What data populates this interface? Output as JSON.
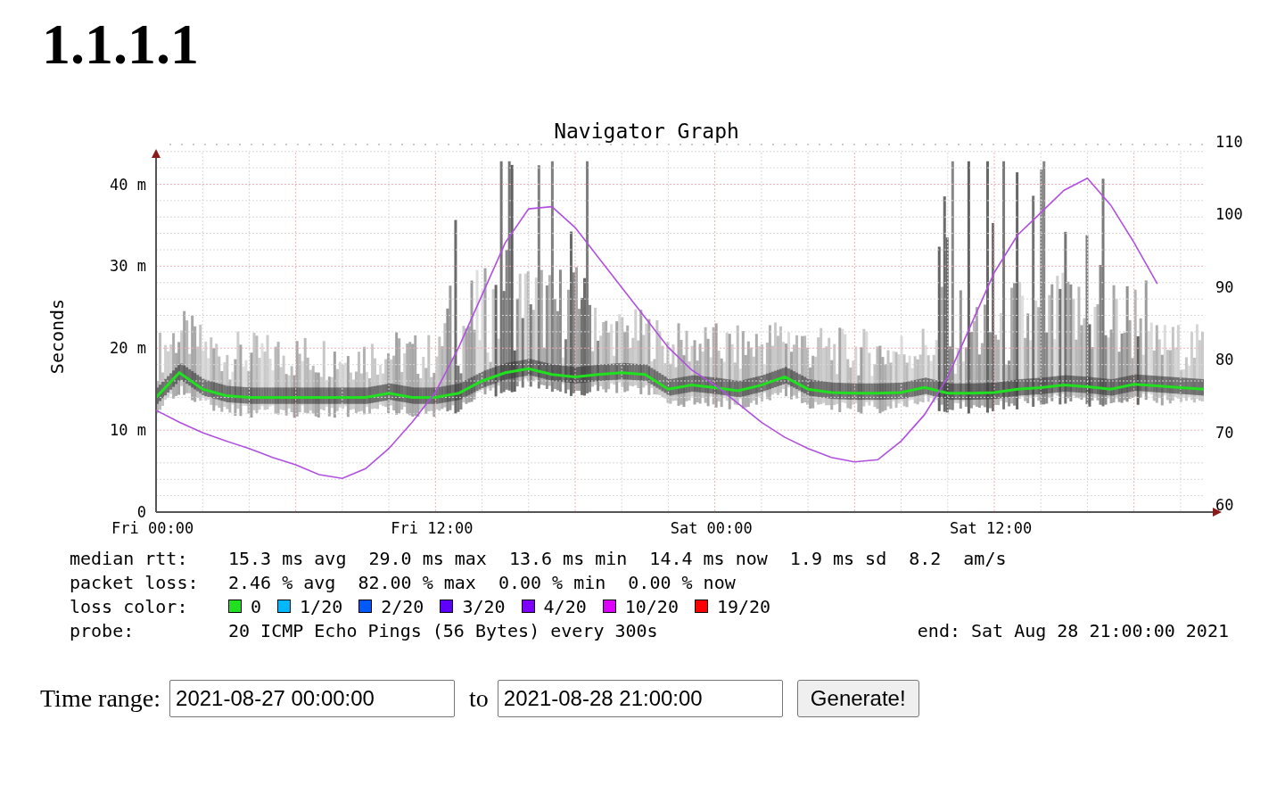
{
  "heading": "1.1.1.1",
  "graph": {
    "chart_data": {
      "type": "line",
      "title": "Navigator Graph",
      "ylabel": "Seconds",
      "categories": [
        "Fri 00:00",
        null,
        null,
        null,
        null,
        null,
        null,
        null,
        null,
        null,
        null,
        null,
        "Fri 12:00",
        null,
        null,
        null,
        null,
        null,
        null,
        null,
        null,
        null,
        null,
        null,
        "Sat 00:00",
        null,
        null,
        null,
        null,
        null,
        null,
        null,
        null,
        null,
        null,
        null,
        "Sat 12:00",
        null,
        null,
        null,
        null,
        null,
        null,
        null,
        null,
        null
      ],
      "ylim": [
        0,
        44.3
      ],
      "grid": true,
      "yticks": [
        {
          "value": 0,
          "label": "0"
        },
        {
          "value": 10,
          "label": "10 m"
        },
        {
          "value": 20,
          "label": "20 m"
        },
        {
          "value": 30,
          "label": "30 m"
        },
        {
          "value": 40,
          "label": "40 m"
        }
      ],
      "series": [
        {
          "color": "#20e020",
          "values": [
            14,
            17,
            15,
            14.2,
            14,
            14,
            14,
            14,
            14,
            14,
            14.5,
            14,
            14,
            14.5,
            16,
            17,
            17.5,
            16.8,
            16.5,
            16.8,
            17,
            16.8,
            15,
            15.5,
            15.2,
            14.8,
            15.5,
            16.5,
            15,
            14.6,
            14.5,
            14.5,
            14.6,
            15.2,
            14.5,
            14.5,
            14.6,
            15,
            15.2,
            15.5,
            15.3,
            15,
            15.6,
            15.4,
            15.2,
            15
          ]
        }
      ]
    },
    "right_axis_labels": [
      "110",
      "100",
      "90",
      "80",
      "70",
      "60"
    ]
  },
  "stats": [
    {
      "kind": "values",
      "label": "median rtt:",
      "values": [
        "15.3 ms avg",
        "29.0 ms max",
        "13.6 ms min",
        "14.4 ms now",
        "1.9 ms sd",
        "8.2",
        "am/s"
      ]
    },
    {
      "kind": "values",
      "label": "packet loss:",
      "values": [
        "2.46 % avg",
        "82.00 % max",
        "0.00 % min",
        "0.00 % now"
      ]
    },
    {
      "kind": "legend",
      "label": "loss color:",
      "items": [
        {
          "label": "0",
          "color": "#20e020"
        },
        {
          "label": "1/20",
          "color": "#00b8ff"
        },
        {
          "label": "2/20",
          "color": "#0059ff"
        },
        {
          "label": "3/20",
          "color": "#5e00ff"
        },
        {
          "label": "4/20",
          "color": "#7e00ff"
        },
        {
          "label": "10/20",
          "color": "#dd00ff"
        },
        {
          "label": "19/20",
          "color": "#ff0000"
        }
      ]
    },
    {
      "kind": "probe",
      "label": "probe:",
      "text": "20 ICMP Echo Pings (56 Bytes) every 300s",
      "end": "end: Sat Aug 28 21:00:00 2021"
    }
  ],
  "form": {
    "label": "Time range:",
    "from": "2021-08-27 00:00:00",
    "separator": "to",
    "until": "2021-08-28 21:00:00",
    "button": "Generate!"
  }
}
